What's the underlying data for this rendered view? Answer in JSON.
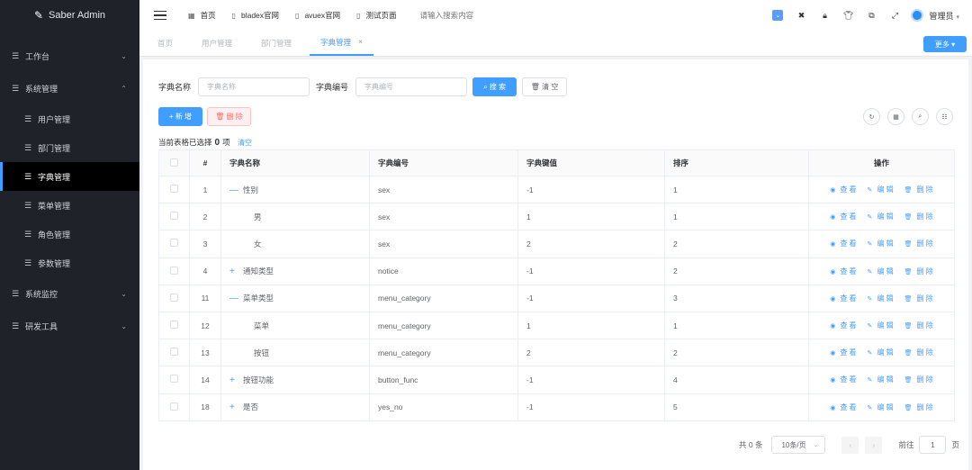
{
  "app": {
    "title": "Saber Admin"
  },
  "sidebar": {
    "items": [
      {
        "label": "工作台",
        "arrow": "⌄"
      },
      {
        "label": "系统管理",
        "arrow": "⌃"
      },
      {
        "label": "系统监控",
        "arrow": "⌄"
      },
      {
        "label": "研发工具",
        "arrow": "⌄"
      }
    ],
    "sub_items": [
      {
        "label": "用户管理"
      },
      {
        "label": "部门管理"
      },
      {
        "label": "字典管理"
      },
      {
        "label": "菜单管理"
      },
      {
        "label": "角色管理"
      },
      {
        "label": "参数管理"
      }
    ]
  },
  "header": {
    "links": [
      {
        "label": "首页"
      },
      {
        "label": "bladex官网"
      },
      {
        "label": "avuex官网"
      },
      {
        "label": "测试页面"
      }
    ],
    "search_placeholder": "请输入搜索内容",
    "user_name": "管理员"
  },
  "tabs": [
    {
      "label": "首页"
    },
    {
      "label": "用户管理"
    },
    {
      "label": "部门管理"
    },
    {
      "label": "字典管理"
    }
  ],
  "more_button": "更多",
  "filter": {
    "name_label": "字典名称",
    "name_placeholder": "字典名称",
    "code_label": "字典编号",
    "code_placeholder": "字典编号",
    "search_button": "搜 索",
    "clear_button": "清 空"
  },
  "actions": {
    "add": "新 增",
    "delete": "删 除"
  },
  "selection": {
    "prefix": "当前表格已选择",
    "count": "0",
    "suffix": "项",
    "clear": "清空"
  },
  "table": {
    "headers": [
      "#",
      "字典名称",
      "字典编号",
      "字典键值",
      "排序",
      "操作"
    ],
    "ops": {
      "view": "查 看",
      "edit": "编 辑",
      "delete": "删 除"
    },
    "rows": [
      {
        "id": "1",
        "name": "性别",
        "code": "sex",
        "key": "-1",
        "sort": "1"
      },
      {
        "id": "2",
        "name": "男",
        "code": "sex",
        "key": "1",
        "sort": "1"
      },
      {
        "id": "3",
        "name": "女",
        "code": "sex",
        "key": "2",
        "sort": "2"
      },
      {
        "id": "4",
        "name": "通知类型",
        "code": "notice",
        "key": "-1",
        "sort": "2"
      },
      {
        "id": "11",
        "name": "菜单类型",
        "code": "menu_category",
        "key": "-1",
        "sort": "3"
      },
      {
        "id": "12",
        "name": "菜单",
        "code": "menu_category",
        "key": "1",
        "sort": "1"
      },
      {
        "id": "13",
        "name": "按钮",
        "code": "menu_category",
        "key": "2",
        "sort": "2"
      },
      {
        "id": "14",
        "name": "按钮功能",
        "code": "button_func",
        "key": "-1",
        "sort": "4"
      },
      {
        "id": "18",
        "name": "是否",
        "code": "yes_no",
        "key": "-1",
        "sort": "5"
      }
    ]
  },
  "pager": {
    "total": "共 0 条",
    "page_size": "10条/页",
    "goto_prefix": "前往",
    "goto_value": "1",
    "goto_suffix": "页"
  },
  "colors": {
    "accent": "#409eff",
    "sidebar_bg": "#20222a",
    "danger": "#f56c6c"
  }
}
